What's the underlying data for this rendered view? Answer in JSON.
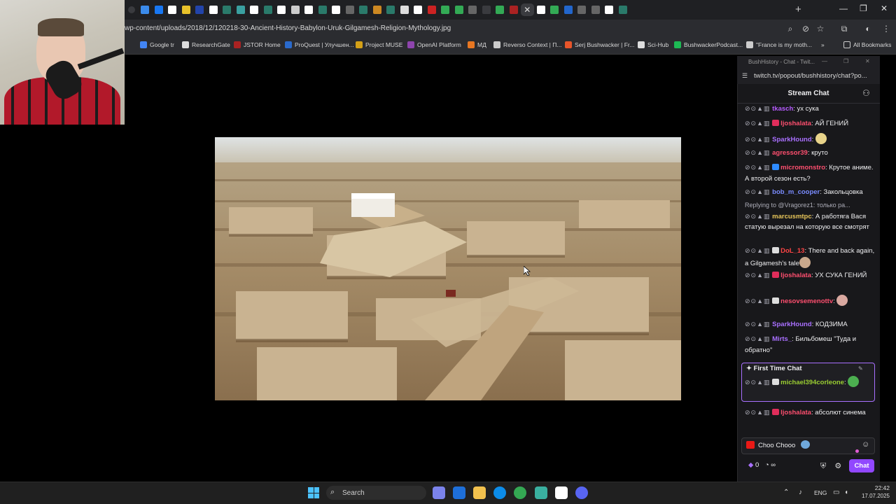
{
  "browser": {
    "tab_colors": [
      "#3a3b3f",
      "#3b8beb",
      "#1877f2",
      "#ffffff",
      "#e8c22a",
      "#2244aa",
      "#ffffff",
      "#2a7a6a",
      "#3aa0a0",
      "#ffffff",
      "#2a7a6a",
      "#ffffff",
      "#cccccc",
      "#ffffff",
      "#2a7a6a",
      "#ffffff",
      "#666666",
      "#2a7a6a",
      "#cc8822",
      "#2a7a6a",
      "#dddddd",
      "#ffffff",
      "#c22",
      "#33aa55",
      "#33aa55",
      "#666666",
      "#3a3b3f",
      "#33aa55",
      "#aa2222",
      "#ffffff",
      "#33aa55",
      "#2266cc",
      "#666666",
      "#666666",
      "#ffffff",
      "#2a7a6a"
    ],
    "active_tab_glyph": "✕",
    "new_tab_glyph": "+",
    "window_controls": [
      "—",
      "❐",
      "✕"
    ],
    "url": "wp-content/uploads/2018/12/120218-30-Ancient-History-Babylon-Uruk-Gilgamesh-Religion-Mythology.jpg",
    "bookmarks": [
      {
        "label": "Google tr",
        "color": "#4285f4"
      },
      {
        "label": "ResearchGate",
        "color": "#dddddd"
      },
      {
        "label": "JSTOR Home",
        "color": "#aa2222"
      },
      {
        "label": "ProQuest | Улучшен...",
        "color": "#2a6acc"
      },
      {
        "label": "Project MUSE",
        "color": "#d4a017"
      },
      {
        "label": "OpenAI Platform",
        "color": "#8e44ad"
      },
      {
        "label": "МД",
        "color": "#e87722"
      },
      {
        "label": "Reverso Context | П...",
        "color": "#cccccc"
      },
      {
        "label": "Serj Bushwacker | Fr...",
        "color": "#e8552a"
      },
      {
        "label": "Sci-Hub",
        "color": "#dddddd"
      },
      {
        "label": "BushwackerPodcast...",
        "color": "#1db954"
      },
      {
        "label": "\"France is my moth...",
        "color": "#cccccc"
      }
    ],
    "bookmarks_more": "»",
    "all_bookmarks": "All Bookmarks"
  },
  "chat": {
    "window_title": "BushHistory - Chat - Twit...",
    "url": "twitch.tv/popout/bushhistory/chat?po...",
    "header_title": "Stream Chat",
    "mod_icons": "⊘⊙▲▥",
    "messages": [
      {
        "user": "tkasch",
        "color": "#b65cff",
        "text": ": ух сука",
        "badge": null
      },
      {
        "user": "ljoshalata",
        "color": "#ff4f6f",
        "text": ": АЙ ГЕНИЙ",
        "badge": "#e02d5b"
      },
      {
        "user": "SparkHound",
        "color": "#a970ff",
        "text": ": ",
        "badge": null,
        "emote": "#e8d38a"
      },
      {
        "user": "agressor39",
        "color": "#ff4f6f",
        "text": ": круто",
        "badge": null
      },
      {
        "user": "micromonstro",
        "color": "#ff4f6f",
        "text": ": Крутое аниме. А второй сезон есть?",
        "badge": "#2e8bff"
      },
      {
        "user": "bob_m_cooper",
        "color": "#7a8cff",
        "text": ": Закольцовка",
        "badge": null
      },
      {
        "reply": "Replying to @Vragorez1: только ра...",
        "user": "marcusmtpc",
        "color": "#e8c65a",
        "text": ": А работяга Вася статую вырезал на которую все смотрят",
        "badge": null
      },
      {
        "user": "DoL_13",
        "color": "#ff4545",
        "text": ": There and back again, a Gilgamesh's tale",
        "badge": "#dddddd",
        "emote": "#c9a88c"
      },
      {
        "user": "ljoshalata",
        "color": "#ff4f6f",
        "text": ": УХ СУКА ГЕНИЙ",
        "badge": "#e02d5b"
      },
      {
        "user": "nesovsemenottv",
        "color": "#ff4f6f",
        "text": ": ",
        "badge": "#dddddd",
        "emote": "#d9a8a0"
      },
      {
        "user": "SparkHound",
        "color": "#a970ff",
        "text": ": КОДЗИМА",
        "badge": null
      },
      {
        "user": "Mirts_",
        "color": "#a970ff",
        "text": ": Бильбомеш \"Туда и обратно\"",
        "badge": null
      },
      {
        "user": "michael394corleone",
        "color": "#9acd32",
        "text": ": ",
        "badge": "#dddddd",
        "emote": "#4caf50"
      },
      {
        "user": "ljoshalata",
        "color": "#ff4f6f",
        "text": ": абсолют синема",
        "badge": "#e02d5b"
      }
    ],
    "first_time_label": "✦ First Time Chat",
    "input_text": "Choo Chooo",
    "points": "0",
    "points_suffix": "∞",
    "send_label": "Chat"
  },
  "taskbar": {
    "search_label": "Search",
    "search_glyph": "⌕",
    "language": "ENG",
    "time": "22:42",
    "date": "17.07.2025",
    "apps": [
      "#7b83eb",
      "#1e6fd9",
      "#f2c14e",
      "#0c8ce9",
      "#34a853",
      "#3ab0a0",
      "#ffffff",
      "#5865f2"
    ]
  }
}
